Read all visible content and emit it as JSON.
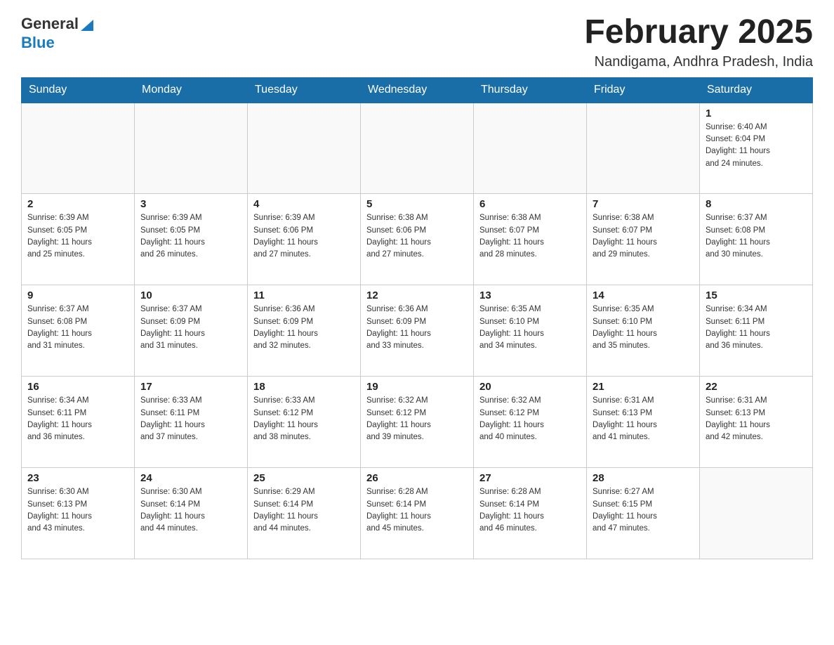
{
  "header": {
    "logo": {
      "general": "General",
      "blue": "Blue"
    },
    "title": "February 2025",
    "location": "Nandigama, Andhra Pradesh, India"
  },
  "weekdays": [
    "Sunday",
    "Monday",
    "Tuesday",
    "Wednesday",
    "Thursday",
    "Friday",
    "Saturday"
  ],
  "weeks": [
    [
      {
        "day": "",
        "info": ""
      },
      {
        "day": "",
        "info": ""
      },
      {
        "day": "",
        "info": ""
      },
      {
        "day": "",
        "info": ""
      },
      {
        "day": "",
        "info": ""
      },
      {
        "day": "",
        "info": ""
      },
      {
        "day": "1",
        "info": "Sunrise: 6:40 AM\nSunset: 6:04 PM\nDaylight: 11 hours\nand 24 minutes."
      }
    ],
    [
      {
        "day": "2",
        "info": "Sunrise: 6:39 AM\nSunset: 6:05 PM\nDaylight: 11 hours\nand 25 minutes."
      },
      {
        "day": "3",
        "info": "Sunrise: 6:39 AM\nSunset: 6:05 PM\nDaylight: 11 hours\nand 26 minutes."
      },
      {
        "day": "4",
        "info": "Sunrise: 6:39 AM\nSunset: 6:06 PM\nDaylight: 11 hours\nand 27 minutes."
      },
      {
        "day": "5",
        "info": "Sunrise: 6:38 AM\nSunset: 6:06 PM\nDaylight: 11 hours\nand 27 minutes."
      },
      {
        "day": "6",
        "info": "Sunrise: 6:38 AM\nSunset: 6:07 PM\nDaylight: 11 hours\nand 28 minutes."
      },
      {
        "day": "7",
        "info": "Sunrise: 6:38 AM\nSunset: 6:07 PM\nDaylight: 11 hours\nand 29 minutes."
      },
      {
        "day": "8",
        "info": "Sunrise: 6:37 AM\nSunset: 6:08 PM\nDaylight: 11 hours\nand 30 minutes."
      }
    ],
    [
      {
        "day": "9",
        "info": "Sunrise: 6:37 AM\nSunset: 6:08 PM\nDaylight: 11 hours\nand 31 minutes."
      },
      {
        "day": "10",
        "info": "Sunrise: 6:37 AM\nSunset: 6:09 PM\nDaylight: 11 hours\nand 31 minutes."
      },
      {
        "day": "11",
        "info": "Sunrise: 6:36 AM\nSunset: 6:09 PM\nDaylight: 11 hours\nand 32 minutes."
      },
      {
        "day": "12",
        "info": "Sunrise: 6:36 AM\nSunset: 6:09 PM\nDaylight: 11 hours\nand 33 minutes."
      },
      {
        "day": "13",
        "info": "Sunrise: 6:35 AM\nSunset: 6:10 PM\nDaylight: 11 hours\nand 34 minutes."
      },
      {
        "day": "14",
        "info": "Sunrise: 6:35 AM\nSunset: 6:10 PM\nDaylight: 11 hours\nand 35 minutes."
      },
      {
        "day": "15",
        "info": "Sunrise: 6:34 AM\nSunset: 6:11 PM\nDaylight: 11 hours\nand 36 minutes."
      }
    ],
    [
      {
        "day": "16",
        "info": "Sunrise: 6:34 AM\nSunset: 6:11 PM\nDaylight: 11 hours\nand 36 minutes."
      },
      {
        "day": "17",
        "info": "Sunrise: 6:33 AM\nSunset: 6:11 PM\nDaylight: 11 hours\nand 37 minutes."
      },
      {
        "day": "18",
        "info": "Sunrise: 6:33 AM\nSunset: 6:12 PM\nDaylight: 11 hours\nand 38 minutes."
      },
      {
        "day": "19",
        "info": "Sunrise: 6:32 AM\nSunset: 6:12 PM\nDaylight: 11 hours\nand 39 minutes."
      },
      {
        "day": "20",
        "info": "Sunrise: 6:32 AM\nSunset: 6:12 PM\nDaylight: 11 hours\nand 40 minutes."
      },
      {
        "day": "21",
        "info": "Sunrise: 6:31 AM\nSunset: 6:13 PM\nDaylight: 11 hours\nand 41 minutes."
      },
      {
        "day": "22",
        "info": "Sunrise: 6:31 AM\nSunset: 6:13 PM\nDaylight: 11 hours\nand 42 minutes."
      }
    ],
    [
      {
        "day": "23",
        "info": "Sunrise: 6:30 AM\nSunset: 6:13 PM\nDaylight: 11 hours\nand 43 minutes."
      },
      {
        "day": "24",
        "info": "Sunrise: 6:30 AM\nSunset: 6:14 PM\nDaylight: 11 hours\nand 44 minutes."
      },
      {
        "day": "25",
        "info": "Sunrise: 6:29 AM\nSunset: 6:14 PM\nDaylight: 11 hours\nand 44 minutes."
      },
      {
        "day": "26",
        "info": "Sunrise: 6:28 AM\nSunset: 6:14 PM\nDaylight: 11 hours\nand 45 minutes."
      },
      {
        "day": "27",
        "info": "Sunrise: 6:28 AM\nSunset: 6:14 PM\nDaylight: 11 hours\nand 46 minutes."
      },
      {
        "day": "28",
        "info": "Sunrise: 6:27 AM\nSunset: 6:15 PM\nDaylight: 11 hours\nand 47 minutes."
      },
      {
        "day": "",
        "info": ""
      }
    ]
  ]
}
